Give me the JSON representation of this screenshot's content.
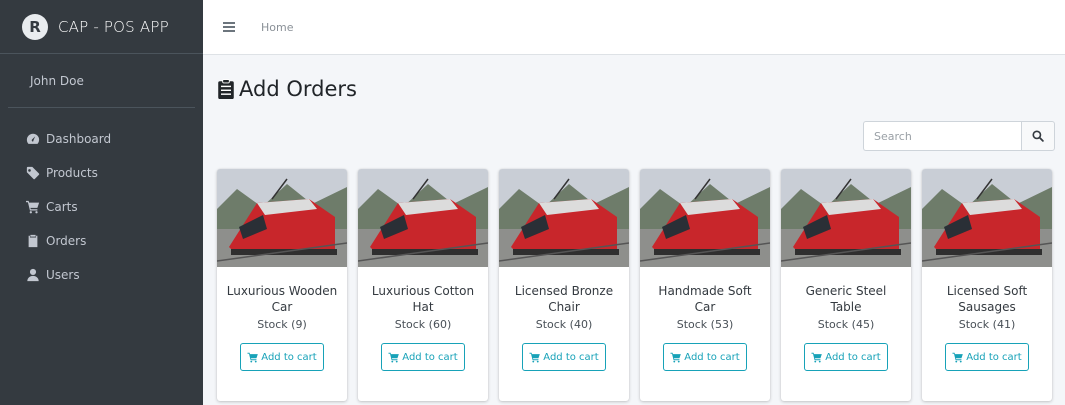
{
  "brand": {
    "name": "CAP - POS APP",
    "logo_letter": "R"
  },
  "user": {
    "name": "John Doe"
  },
  "sidebar": {
    "items": [
      {
        "label": "Dashboard",
        "icon": "tachometer-icon"
      },
      {
        "label": "Products",
        "icon": "tag-icon"
      },
      {
        "label": "Carts",
        "icon": "cart-icon"
      },
      {
        "label": "Orders",
        "icon": "clipboard-icon"
      },
      {
        "label": "Users",
        "icon": "user-icon"
      }
    ]
  },
  "topbar": {
    "home_label": "Home"
  },
  "page": {
    "title": "Add Orders"
  },
  "search": {
    "placeholder": "Search",
    "value": ""
  },
  "products": [
    {
      "name": "Luxurious Wooden Car",
      "stock": "Stock (9)",
      "button": "Add to cart"
    },
    {
      "name": "Luxurious Cotton Hat",
      "stock": "Stock (60)",
      "button": "Add to cart"
    },
    {
      "name": "Licensed Bronze Chair",
      "stock": "Stock (40)",
      "button": "Add to cart"
    },
    {
      "name": "Handmade Soft Car",
      "stock": "Stock (53)",
      "button": "Add to cart"
    },
    {
      "name": "Generic Steel Table",
      "stock": "Stock (45)",
      "button": "Add to cart"
    },
    {
      "name": "Licensed Soft Sausages",
      "stock": "Stock (41)",
      "button": "Add to cart"
    }
  ],
  "colors": {
    "sidebar_bg": "#343a40",
    "accent": "#17a2b8",
    "page_bg": "#f4f6f9"
  }
}
